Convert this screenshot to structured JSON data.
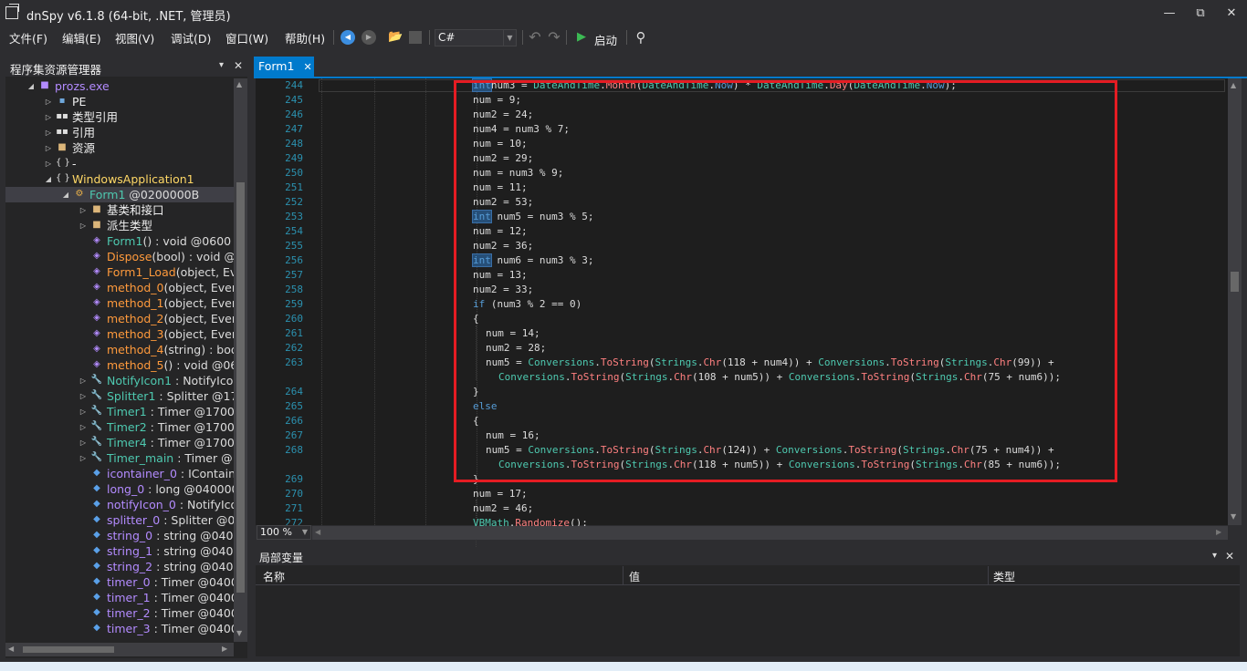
{
  "window": {
    "title": "dnSpy v6.1.8 (64-bit, .NET, 管理员)",
    "minimize": "—",
    "restore": "⧉",
    "close": "✕"
  },
  "menu": [
    "文件(F)",
    "编辑(E)",
    "视图(V)",
    "调试(D)",
    "窗口(W)",
    "帮助(H)"
  ],
  "toolbar": {
    "back": "◀",
    "forward": "▶",
    "open": "📂",
    "lang": "C#",
    "undo": "↶",
    "redo": "↷",
    "start_icon": "▶",
    "start_label": "启动",
    "search": "⚲"
  },
  "left_panel": {
    "title": "程序集资源管理器",
    "pin": "▾",
    "close": "✕"
  },
  "tree": [
    {
      "indent": 0,
      "toggle": "◢",
      "icon": "asm",
      "label": "prozs.exe",
      "color": "#b38bff"
    },
    {
      "indent": 1,
      "toggle": "▷",
      "icon": "pe",
      "label": "PE",
      "color": "#f1f1f1"
    },
    {
      "indent": 1,
      "toggle": "▷",
      "icon": "ref",
      "label": "类型引用",
      "color": "#f1f1f1"
    },
    {
      "indent": 1,
      "toggle": "▷",
      "icon": "ref",
      "label": "引用",
      "color": "#f1f1f1"
    },
    {
      "indent": 1,
      "toggle": "▷",
      "icon": "folder",
      "label": "资源",
      "color": "#f1f1f1"
    },
    {
      "indent": 1,
      "toggle": "▷",
      "icon": "ns",
      "label": "-",
      "color": "#f1f1f1"
    },
    {
      "indent": 1,
      "toggle": "◢",
      "icon": "ns",
      "label": "WindowsApplication1",
      "color": "#ffd866"
    },
    {
      "indent": 2,
      "toggle": "◢",
      "icon": "class",
      "label": "Form1",
      "suffix": " @0200000B",
      "color": "#4ec9b0",
      "selected": true
    },
    {
      "indent": 3,
      "toggle": "▷",
      "icon": "folder",
      "label": "基类和接口",
      "color": "#f1f1f1"
    },
    {
      "indent": 3,
      "toggle": "▷",
      "icon": "folder",
      "label": "派生类型",
      "color": "#f1f1f1"
    },
    {
      "indent": 3,
      "toggle": "",
      "icon": "method",
      "label": "Form1",
      "suffix": "() : void @0600",
      "color": "#4ec9b0"
    },
    {
      "indent": 3,
      "toggle": "",
      "icon": "method",
      "label": "Dispose",
      "suffix": "(bool) : void @",
      "color": "#ff9a3c"
    },
    {
      "indent": 3,
      "toggle": "",
      "icon": "method",
      "label": "Form1_Load",
      "suffix": "(object, Eve",
      "color": "#ff9a3c"
    },
    {
      "indent": 3,
      "toggle": "",
      "icon": "method",
      "label": "method_0",
      "suffix": "(object, Event",
      "color": "#ff9a3c"
    },
    {
      "indent": 3,
      "toggle": "",
      "icon": "method",
      "label": "method_1",
      "suffix": "(object, Event",
      "color": "#ff9a3c"
    },
    {
      "indent": 3,
      "toggle": "",
      "icon": "method",
      "label": "method_2",
      "suffix": "(object, Event",
      "color": "#ff9a3c"
    },
    {
      "indent": 3,
      "toggle": "",
      "icon": "method",
      "label": "method_3",
      "suffix": "(object, Event",
      "color": "#ff9a3c"
    },
    {
      "indent": 3,
      "toggle": "",
      "icon": "method",
      "label": "method_4",
      "suffix": "(string) : boo",
      "color": "#ff9a3c"
    },
    {
      "indent": 3,
      "toggle": "",
      "icon": "method",
      "label": "method_5",
      "suffix": "() : void @06",
      "color": "#ff9a3c"
    },
    {
      "indent": 3,
      "toggle": "▷",
      "icon": "wrench",
      "label": "NotifyIcon1",
      "suffix": " : NotifyIcon",
      "color": "#4ec9b0"
    },
    {
      "indent": 3,
      "toggle": "▷",
      "icon": "wrench",
      "label": "Splitter1",
      "suffix": " : Splitter @170",
      "color": "#4ec9b0"
    },
    {
      "indent": 3,
      "toggle": "▷",
      "icon": "wrench",
      "label": "Timer1",
      "suffix": " : Timer @17000",
      "color": "#4ec9b0"
    },
    {
      "indent": 3,
      "toggle": "▷",
      "icon": "wrench",
      "label": "Timer2",
      "suffix": " : Timer @17000",
      "color": "#4ec9b0"
    },
    {
      "indent": 3,
      "toggle": "▷",
      "icon": "wrench",
      "label": "Timer4",
      "suffix": " : Timer @17000",
      "color": "#4ec9b0"
    },
    {
      "indent": 3,
      "toggle": "▷",
      "icon": "wrench",
      "label": "Timer_main",
      "suffix": " : Timer @1",
      "color": "#4ec9b0"
    },
    {
      "indent": 3,
      "toggle": "",
      "icon": "field",
      "label": "icontainer_0",
      "suffix": " : IContaine",
      "color": "#b38bff"
    },
    {
      "indent": 3,
      "toggle": "",
      "icon": "field",
      "label": "long_0",
      "suffix": " : long @040000",
      "color": "#b38bff"
    },
    {
      "indent": 3,
      "toggle": "",
      "icon": "field",
      "label": "notifyIcon_0",
      "suffix": " : NotifyIco",
      "color": "#b38bff"
    },
    {
      "indent": 3,
      "toggle": "",
      "icon": "field",
      "label": "splitter_0",
      "suffix": " : Splitter @04",
      "color": "#b38bff"
    },
    {
      "indent": 3,
      "toggle": "",
      "icon": "field",
      "label": "string_0",
      "suffix": " : string @0400",
      "color": "#b38bff"
    },
    {
      "indent": 3,
      "toggle": "",
      "icon": "field",
      "label": "string_1",
      "suffix": " : string @0400",
      "color": "#b38bff"
    },
    {
      "indent": 3,
      "toggle": "",
      "icon": "field",
      "label": "string_2",
      "suffix": " : string @0400",
      "color": "#b38bff"
    },
    {
      "indent": 3,
      "toggle": "",
      "icon": "field",
      "label": "timer_0",
      "suffix": " : Timer @04000",
      "color": "#b38bff"
    },
    {
      "indent": 3,
      "toggle": "",
      "icon": "field",
      "label": "timer_1",
      "suffix": " : Timer @04000",
      "color": "#b38bff"
    },
    {
      "indent": 3,
      "toggle": "",
      "icon": "field",
      "label": "timer_2",
      "suffix": " : Timer @04000",
      "color": "#b38bff"
    },
    {
      "indent": 3,
      "toggle": "",
      "icon": "field",
      "label": "timer_3",
      "suffix": " : Timer @04000",
      "color": "#b38bff"
    }
  ],
  "editor": {
    "tab": "Form1",
    "tab_close": "✕",
    "zoom": "100 %",
    "lines": [
      {
        "n": "244",
        "indent": 0,
        "code": [
          [
            "kwsel",
            "int"
          ],
          [
            "",
            "num3 = "
          ],
          [
            "cls",
            "DateAndTime"
          ],
          [
            "",
            "."
          ],
          [
            "mth",
            "Month"
          ],
          [
            "",
            "("
          ],
          [
            "cls",
            "DateAndTime"
          ],
          [
            "",
            "."
          ],
          [
            "kw",
            "Now"
          ],
          [
            "",
            ") * "
          ],
          [
            "cls",
            "DateAndTime"
          ],
          [
            "",
            "."
          ],
          [
            "mth",
            "Day"
          ],
          [
            "",
            "("
          ],
          [
            "cls",
            "DateAndTime"
          ],
          [
            "",
            "."
          ],
          [
            "kw",
            "Now"
          ],
          [
            "",
            ");"
          ]
        ]
      },
      {
        "n": "245",
        "indent": 0,
        "code": [
          [
            "",
            "num = 9;"
          ]
        ]
      },
      {
        "n": "246",
        "indent": 0,
        "code": [
          [
            "",
            "num2 = 24;"
          ]
        ]
      },
      {
        "n": "247",
        "indent": 0,
        "code": [
          [
            "",
            "num4 = num3 % 7;"
          ]
        ]
      },
      {
        "n": "248",
        "indent": 0,
        "code": [
          [
            "",
            "num = 10;"
          ]
        ]
      },
      {
        "n": "249",
        "indent": 0,
        "code": [
          [
            "",
            "num2 = 29;"
          ]
        ]
      },
      {
        "n": "250",
        "indent": 0,
        "code": [
          [
            "",
            "num = num3 % 9;"
          ]
        ]
      },
      {
        "n": "251",
        "indent": 0,
        "code": [
          [
            "",
            "num = 11;"
          ]
        ]
      },
      {
        "n": "252",
        "indent": 0,
        "code": [
          [
            "",
            "num2 = 53;"
          ]
        ]
      },
      {
        "n": "253",
        "indent": 0,
        "code": [
          [
            "kwsel",
            "int"
          ],
          [
            "",
            " num5 = num3 % 5;"
          ]
        ]
      },
      {
        "n": "254",
        "indent": 0,
        "code": [
          [
            "",
            "num = 12;"
          ]
        ]
      },
      {
        "n": "255",
        "indent": 0,
        "code": [
          [
            "",
            "num2 = 36;"
          ]
        ]
      },
      {
        "n": "256",
        "indent": 0,
        "code": [
          [
            "kwsel",
            "int"
          ],
          [
            "",
            " num6 = num3 % 3;"
          ]
        ]
      },
      {
        "n": "257",
        "indent": 0,
        "code": [
          [
            "",
            "num = 13;"
          ]
        ]
      },
      {
        "n": "258",
        "indent": 0,
        "code": [
          [
            "",
            "num2 = 33;"
          ]
        ]
      },
      {
        "n": "259",
        "indent": 0,
        "code": [
          [
            "kw",
            "if"
          ],
          [
            "",
            " (num3 % 2 == 0)"
          ]
        ]
      },
      {
        "n": "260",
        "indent": 0,
        "code": [
          [
            "",
            "{"
          ]
        ]
      },
      {
        "n": "261",
        "indent": 1,
        "code": [
          [
            "",
            "num = 14;"
          ]
        ]
      },
      {
        "n": "262",
        "indent": 1,
        "code": [
          [
            "",
            "num2 = 28;"
          ]
        ]
      },
      {
        "n": "263",
        "indent": 1,
        "code": [
          [
            "",
            "num5 = "
          ],
          [
            "cls",
            "Conversions"
          ],
          [
            "",
            "."
          ],
          [
            "mth",
            "ToString"
          ],
          [
            "",
            "("
          ],
          [
            "cls",
            "Strings"
          ],
          [
            "",
            "."
          ],
          [
            "mth",
            "Chr"
          ],
          [
            "",
            "(118 + num4)) + "
          ],
          [
            "cls",
            "Conversions"
          ],
          [
            "",
            "."
          ],
          [
            "mth",
            "ToString"
          ],
          [
            "",
            "("
          ],
          [
            "cls",
            "Strings"
          ],
          [
            "",
            "."
          ],
          [
            "mth",
            "Chr"
          ],
          [
            "",
            "(99)) +"
          ]
        ]
      },
      {
        "n": "",
        "indent": 2,
        "code": [
          [
            "cls",
            "Conversions"
          ],
          [
            "",
            "."
          ],
          [
            "mth",
            "ToString"
          ],
          [
            "",
            "("
          ],
          [
            "cls",
            "Strings"
          ],
          [
            "",
            "."
          ],
          [
            "mth",
            "Chr"
          ],
          [
            "",
            "(108 + num5)) + "
          ],
          [
            "cls",
            "Conversions"
          ],
          [
            "",
            "."
          ],
          [
            "mth",
            "ToString"
          ],
          [
            "",
            "("
          ],
          [
            "cls",
            "Strings"
          ],
          [
            "",
            "."
          ],
          [
            "mth",
            "Chr"
          ],
          [
            "",
            "(75 + num6));"
          ]
        ]
      },
      {
        "n": "264",
        "indent": 0,
        "code": [
          [
            "",
            "}"
          ]
        ]
      },
      {
        "n": "265",
        "indent": 0,
        "code": [
          [
            "kw",
            "else"
          ]
        ]
      },
      {
        "n": "266",
        "indent": 0,
        "code": [
          [
            "",
            "{"
          ]
        ]
      },
      {
        "n": "267",
        "indent": 1,
        "code": [
          [
            "",
            "num = 16;"
          ]
        ]
      },
      {
        "n": "268",
        "indent": 1,
        "code": [
          [
            "",
            "num5 = "
          ],
          [
            "cls",
            "Conversions"
          ],
          [
            "",
            "."
          ],
          [
            "mth",
            "ToString"
          ],
          [
            "",
            "("
          ],
          [
            "cls",
            "Strings"
          ],
          [
            "",
            "."
          ],
          [
            "mth",
            "Chr"
          ],
          [
            "",
            "(124)) + "
          ],
          [
            "cls",
            "Conversions"
          ],
          [
            "",
            "."
          ],
          [
            "mth",
            "ToString"
          ],
          [
            "",
            "("
          ],
          [
            "cls",
            "Strings"
          ],
          [
            "",
            "."
          ],
          [
            "mth",
            "Chr"
          ],
          [
            "",
            "(75 + num4)) +"
          ]
        ]
      },
      {
        "n": "",
        "indent": 2,
        "code": [
          [
            "cls",
            "Conversions"
          ],
          [
            "",
            "."
          ],
          [
            "mth",
            "ToString"
          ],
          [
            "",
            "("
          ],
          [
            "cls",
            "Strings"
          ],
          [
            "",
            "."
          ],
          [
            "mth",
            "Chr"
          ],
          [
            "",
            "(118 + num5)) + "
          ],
          [
            "cls",
            "Conversions"
          ],
          [
            "",
            "."
          ],
          [
            "mth",
            "ToString"
          ],
          [
            "",
            "("
          ],
          [
            "cls",
            "Strings"
          ],
          [
            "",
            "."
          ],
          [
            "mth",
            "Chr"
          ],
          [
            "",
            "(85 + num6));"
          ]
        ]
      },
      {
        "n": "269",
        "indent": 0,
        "code": [
          [
            "",
            "}"
          ]
        ]
      },
      {
        "n": "270",
        "indent": 0,
        "code": [
          [
            "",
            "num = 17;"
          ]
        ]
      },
      {
        "n": "271",
        "indent": 0,
        "code": [
          [
            "",
            "num2 = 46;"
          ]
        ]
      },
      {
        "n": "272",
        "indent": 0,
        "code": [
          [
            "cls",
            "VBMath"
          ],
          [
            "",
            "."
          ],
          [
            "mth",
            "Randomize"
          ],
          [
            "",
            "();"
          ]
        ]
      }
    ]
  },
  "locals": {
    "title": "局部变量",
    "pin": "▾",
    "close": "✕",
    "columns": [
      "名称",
      "值",
      "类型"
    ]
  }
}
